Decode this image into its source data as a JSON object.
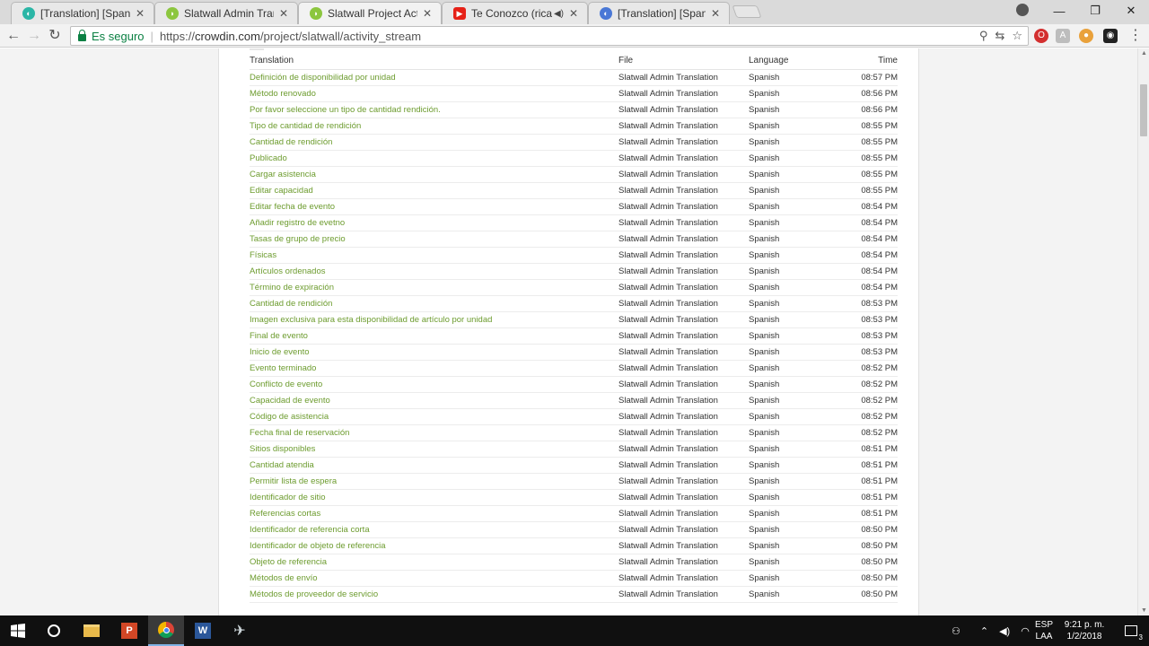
{
  "browser": {
    "tabs": [
      {
        "title": "[Translation] [Spanish] O",
        "favicon": "crowdin-icon",
        "color": "#2bb6a6"
      },
      {
        "title": "Slatwall Admin Translatio",
        "favicon": "slatwall-icon",
        "color": "#8cc63f"
      },
      {
        "title": "Slatwall Project Activity S",
        "favicon": "slatwall-icon",
        "color": "#8cc63f"
      },
      {
        "title": "Te Conozco (ricardo a",
        "favicon": "youtube-icon",
        "color": "#e62117"
      },
      {
        "title": "[Translation] [Spanish] Sl",
        "favicon": "crowdin-icon",
        "color": "#4a78d6"
      }
    ],
    "active_tab": 2,
    "secure_label": "Es seguro",
    "url_scheme": "https://",
    "url_host": "crowdin.com",
    "url_path": "/project/slatwall/activity_stream",
    "window_controls": {
      "minimize": "—",
      "maximize": "❐",
      "close": "✕"
    }
  },
  "table": {
    "headers": {
      "translation": "Translation",
      "file": "File",
      "language": "Language",
      "time": "Time"
    },
    "rows": [
      {
        "translation": "Definición de disponibilidad por unidad",
        "file": "Slatwall Admin Translation",
        "language": "Spanish",
        "time": "08:57 PM"
      },
      {
        "translation": "Método renovado",
        "file": "Slatwall Admin Translation",
        "language": "Spanish",
        "time": "08:56 PM"
      },
      {
        "translation": "Por favor seleccione un tipo de cantidad rendición.",
        "file": "Slatwall Admin Translation",
        "language": "Spanish",
        "time": "08:56 PM"
      },
      {
        "translation": "Tipo de cantidad de rendición",
        "file": "Slatwall Admin Translation",
        "language": "Spanish",
        "time": "08:55 PM"
      },
      {
        "translation": "Cantidad de rendición",
        "file": "Slatwall Admin Translation",
        "language": "Spanish",
        "time": "08:55 PM"
      },
      {
        "translation": "Publicado",
        "file": "Slatwall Admin Translation",
        "language": "Spanish",
        "time": "08:55 PM"
      },
      {
        "translation": "Cargar asistencia",
        "file": "Slatwall Admin Translation",
        "language": "Spanish",
        "time": "08:55 PM"
      },
      {
        "translation": "Editar capacidad",
        "file": "Slatwall Admin Translation",
        "language": "Spanish",
        "time": "08:55 PM"
      },
      {
        "translation": "Editar fecha de evento",
        "file": "Slatwall Admin Translation",
        "language": "Spanish",
        "time": "08:54 PM"
      },
      {
        "translation": "Añadir registro de evetno",
        "file": "Slatwall Admin Translation",
        "language": "Spanish",
        "time": "08:54 PM"
      },
      {
        "translation": "Tasas de grupo de precio",
        "file": "Slatwall Admin Translation",
        "language": "Spanish",
        "time": "08:54 PM"
      },
      {
        "translation": "Físicas",
        "file": "Slatwall Admin Translation",
        "language": "Spanish",
        "time": "08:54 PM"
      },
      {
        "translation": "Artículos ordenados",
        "file": "Slatwall Admin Translation",
        "language": "Spanish",
        "time": "08:54 PM"
      },
      {
        "translation": "Término de expiración",
        "file": "Slatwall Admin Translation",
        "language": "Spanish",
        "time": "08:54 PM"
      },
      {
        "translation": "Cantidad de rendición",
        "file": "Slatwall Admin Translation",
        "language": "Spanish",
        "time": "08:53 PM"
      },
      {
        "translation": "Imagen exclusiva para esta disponibilidad de artículo por unidad",
        "file": "Slatwall Admin Translation",
        "language": "Spanish",
        "time": "08:53 PM"
      },
      {
        "translation": "Final de evento",
        "file": "Slatwall Admin Translation",
        "language": "Spanish",
        "time": "08:53 PM"
      },
      {
        "translation": "Inicio de evento",
        "file": "Slatwall Admin Translation",
        "language": "Spanish",
        "time": "08:53 PM"
      },
      {
        "translation": "Evento terminado",
        "file": "Slatwall Admin Translation",
        "language": "Spanish",
        "time": "08:52 PM"
      },
      {
        "translation": "Conflicto de evento",
        "file": "Slatwall Admin Translation",
        "language": "Spanish",
        "time": "08:52 PM"
      },
      {
        "translation": "Capacidad de evento",
        "file": "Slatwall Admin Translation",
        "language": "Spanish",
        "time": "08:52 PM"
      },
      {
        "translation": "Código de asistencia",
        "file": "Slatwall Admin Translation",
        "language": "Spanish",
        "time": "08:52 PM"
      },
      {
        "translation": "Fecha final de reservación",
        "file": "Slatwall Admin Translation",
        "language": "Spanish",
        "time": "08:52 PM"
      },
      {
        "translation": "Sitios disponibles",
        "file": "Slatwall Admin Translation",
        "language": "Spanish",
        "time": "08:51 PM"
      },
      {
        "translation": "Cantidad atendia",
        "file": "Slatwall Admin Translation",
        "language": "Spanish",
        "time": "08:51 PM"
      },
      {
        "translation": "Permitir lista de espera",
        "file": "Slatwall Admin Translation",
        "language": "Spanish",
        "time": "08:51 PM"
      },
      {
        "translation": "Identificador de sitio",
        "file": "Slatwall Admin Translation",
        "language": "Spanish",
        "time": "08:51 PM"
      },
      {
        "translation": "Referencias cortas",
        "file": "Slatwall Admin Translation",
        "language": "Spanish",
        "time": "08:51 PM"
      },
      {
        "translation": "Identificador de referencia corta",
        "file": "Slatwall Admin Translation",
        "language": "Spanish",
        "time": "08:50 PM"
      },
      {
        "translation": "Identificador de objeto de referencia",
        "file": "Slatwall Admin Translation",
        "language": "Spanish",
        "time": "08:50 PM"
      },
      {
        "translation": "Objeto de referencia",
        "file": "Slatwall Admin Translation",
        "language": "Spanish",
        "time": "08:50 PM"
      },
      {
        "translation": "Métodos de envío",
        "file": "Slatwall Admin Translation",
        "language": "Spanish",
        "time": "08:50 PM"
      },
      {
        "translation": "Métodos de proveedor de servicio",
        "file": "Slatwall Admin Translation",
        "language": "Spanish",
        "time": "08:50 PM"
      }
    ],
    "link_color": "#6d9c2f"
  },
  "taskbar": {
    "language": "ESP",
    "language_sub": "LAA",
    "time": "9:21 p. m.",
    "date": "1/2/2018",
    "notification_count": "3"
  }
}
